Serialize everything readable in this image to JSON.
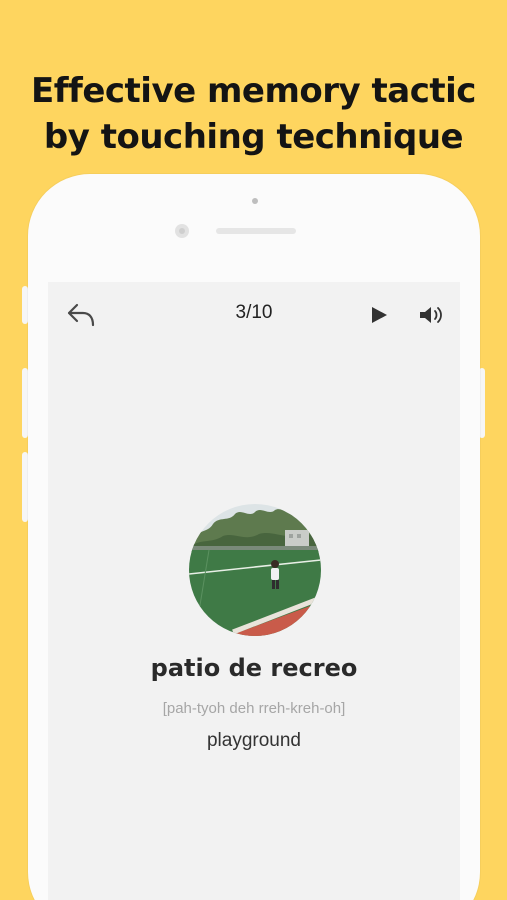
{
  "headline": {
    "line1": "Effective memory tactic",
    "line2": "by touching technique"
  },
  "toolbar": {
    "back_icon": "reply-arrow-icon",
    "counter": "3/10",
    "play_icon": "play-icon",
    "sound_icon": "speaker-icon"
  },
  "card": {
    "image": "playground-photo",
    "word": "patio de recreo",
    "pronunciation": "[pah-tyoh deh rreh-kreh-oh]",
    "meaning": "playground"
  },
  "colors": {
    "background": "#FED55F",
    "phone": "#FBFBFB",
    "screen": "#F2F2F2"
  }
}
